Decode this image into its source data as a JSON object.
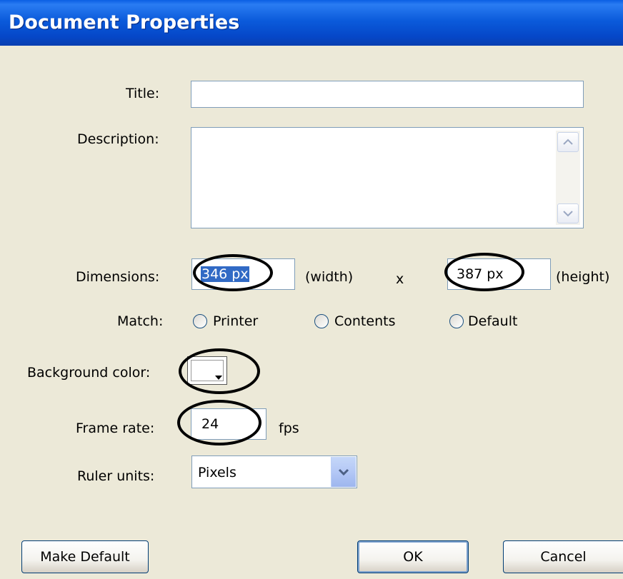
{
  "window": {
    "title": "Document Properties"
  },
  "form": {
    "title_label": "Title:",
    "title_value": "",
    "description_label": "Description:",
    "description_value": "",
    "dimensions_label": "Dimensions:",
    "width_value": "346 px",
    "width_unit_label": "(width)",
    "times_label": "x",
    "height_value": "387 px",
    "height_unit_label": "(height)",
    "match_label": "Match:",
    "match_options": [
      "Printer",
      "Contents",
      "Default"
    ],
    "background_color_label": "Background color:",
    "background_color": "#FFFFFF",
    "frame_rate_label": "Frame rate:",
    "frame_rate_value": "24",
    "frame_rate_unit": "fps",
    "ruler_units_label": "Ruler units:",
    "ruler_units_value": "Pixels"
  },
  "buttons": {
    "make_default": "Make Default",
    "ok": "OK",
    "cancel": "Cancel"
  },
  "colors": {
    "titlebar": "#0A5FE4",
    "dialog_bg": "#ECE9D8",
    "selection": "#316AC5",
    "annotation": "#000000"
  }
}
